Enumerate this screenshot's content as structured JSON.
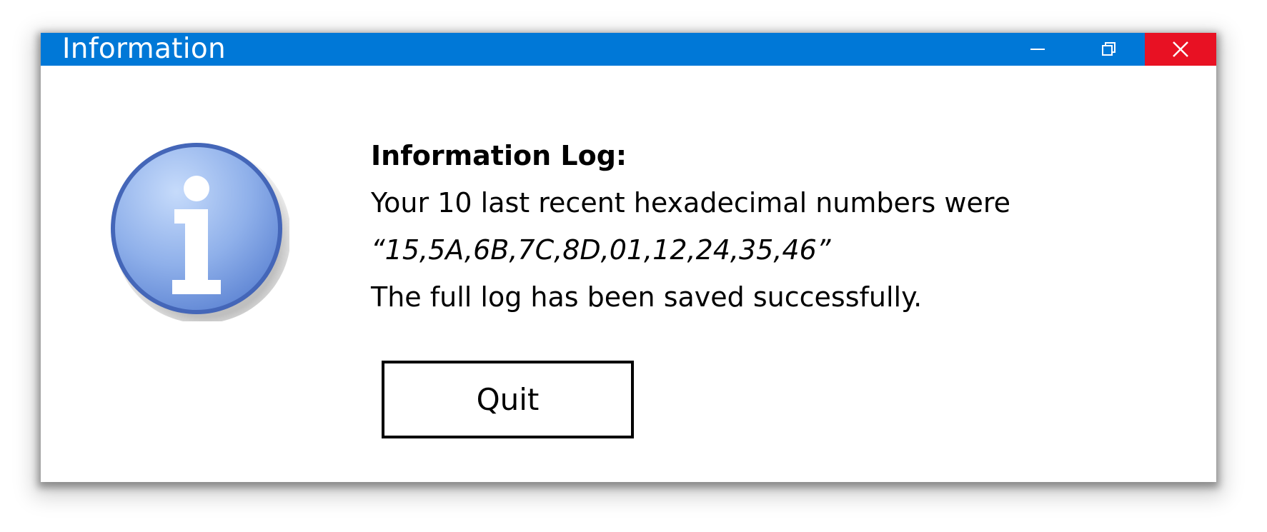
{
  "window": {
    "title": "Information",
    "controls": {
      "minimize_icon": "minimize-icon",
      "restore_icon": "restore-icon",
      "close_icon": "close-icon"
    },
    "colors": {
      "titlebar": "#0078d7",
      "close_button": "#e81123",
      "icon_blue": "#5a80cf"
    }
  },
  "message": {
    "icon": "info-icon",
    "heading": "Information Log:",
    "line1": "Your 10 last recent hexadecimal numbers were",
    "line2": "“15,5A,6B,7C,8D,01,12,24,35,46”",
    "line3": "The full log has been saved successfully."
  },
  "buttons": {
    "quit_label": "Quit"
  }
}
